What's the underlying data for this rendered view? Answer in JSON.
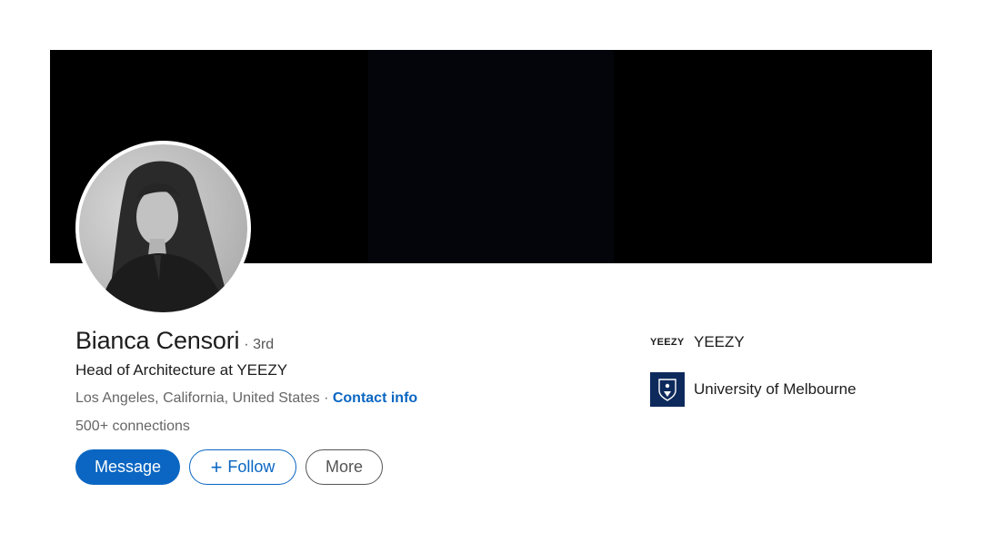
{
  "profile": {
    "name": "Bianca Censori",
    "degree": "· 3rd",
    "headline": "Head of Architecture at YEEZY",
    "location": "Los Angeles, California, United States",
    "separator": "·",
    "contact_label": "Contact info",
    "connections": "500+ connections"
  },
  "actions": {
    "message_label": "Message",
    "follow_plus": "+",
    "follow_label": "Follow",
    "more_label": "More"
  },
  "orgs": [
    {
      "logo_text": "YEEZY",
      "name": "YEEZY"
    },
    {
      "name": "University of Melbourne"
    }
  ],
  "colors": {
    "accent": "#0a66c2",
    "banner": "#000000",
    "crest": "#0e2a5c"
  },
  "icons": {
    "avatar": "profile-photo",
    "university": "university-crest-icon"
  }
}
